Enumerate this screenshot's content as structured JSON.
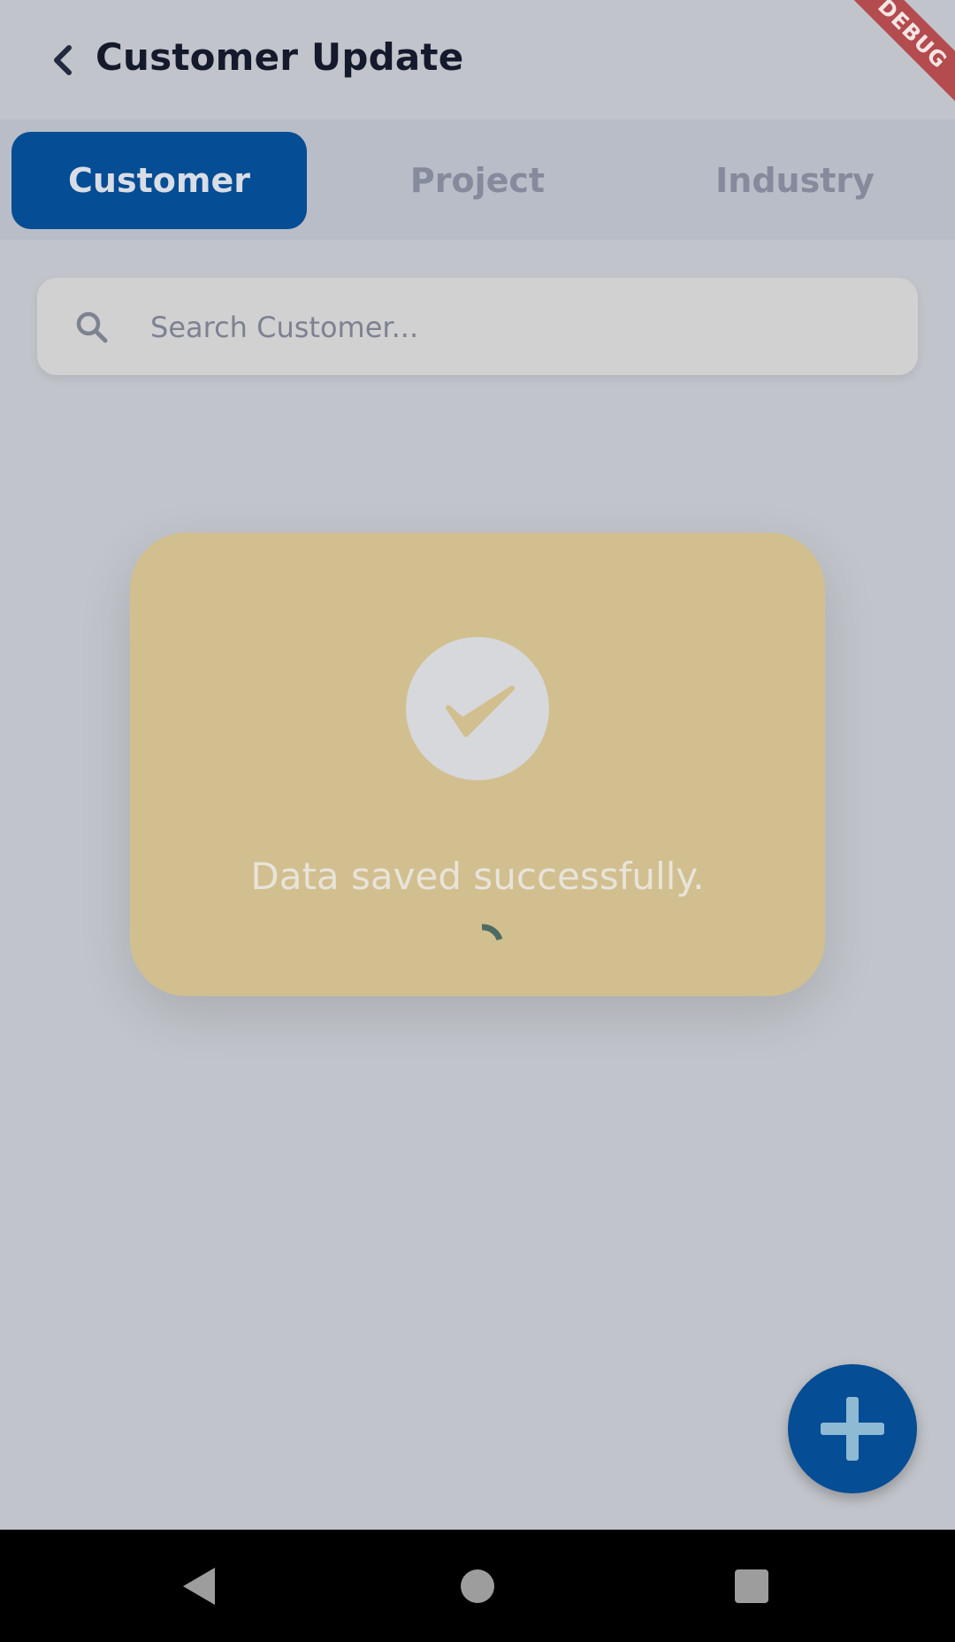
{
  "header": {
    "title": "Customer Update",
    "back_icon": "chevron-left-icon"
  },
  "debug_banner": {
    "label": "DEBUG",
    "color": "#b44b4e"
  },
  "tabs": [
    {
      "label": "Customer",
      "active": true
    },
    {
      "label": "Project",
      "active": false
    },
    {
      "label": "Industry",
      "active": false
    }
  ],
  "search": {
    "placeholder": "Search Customer...",
    "value": "",
    "icon": "search-icon"
  },
  "dialog": {
    "message": "Data saved successfully.",
    "icon": "checkmark-icon",
    "background": "#d2bf8f",
    "loading": true
  },
  "fab": {
    "icon": "plus-icon",
    "color": "#054d94"
  },
  "nav": {
    "back_icon": "nav-back-icon",
    "home_icon": "nav-home-icon",
    "recents_icon": "nav-recents-icon"
  },
  "colors": {
    "accent": "#054d94",
    "overlay_bg": "#c1c4ca"
  }
}
